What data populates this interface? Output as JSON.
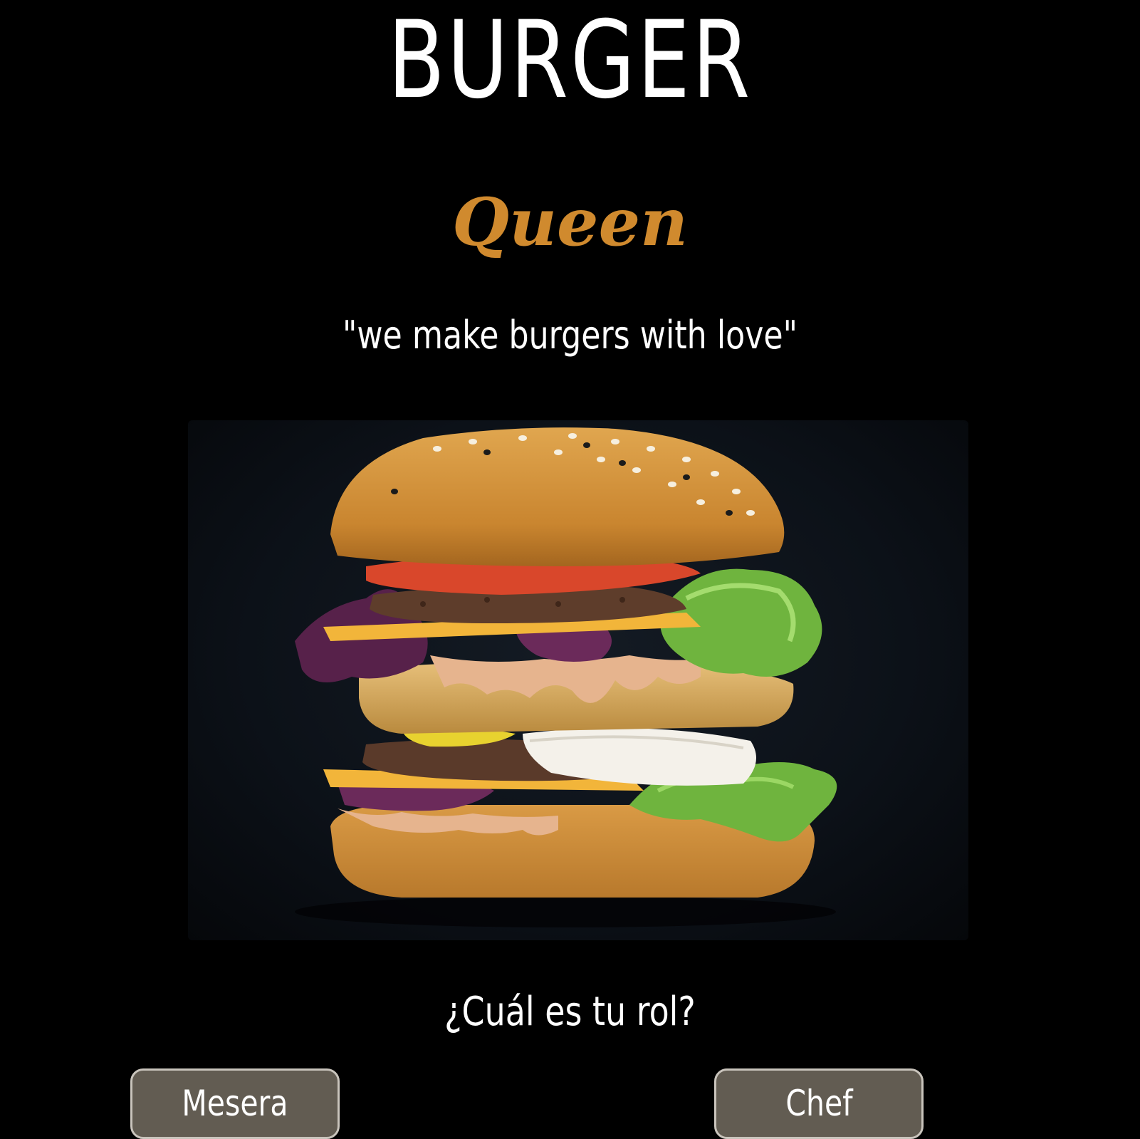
{
  "header": {
    "title": "BURGER",
    "subtitle": "Queen",
    "tagline": "\"we make burgers with love\""
  },
  "hero_image": {
    "icon": "burger-photo",
    "subject": "stacked double cheeseburger"
  },
  "role_prompt": {
    "question": "¿Cuál es tu rol?",
    "options": [
      {
        "label": "Mesera"
      },
      {
        "label": "Chef"
      }
    ]
  },
  "colors": {
    "background": "#000000",
    "accent": "#d08a2e",
    "button_bg": "#625c52",
    "button_border": "#c9c4bc",
    "text": "#ffffff"
  }
}
